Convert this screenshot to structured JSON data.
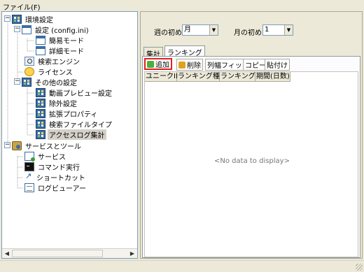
{
  "menu": {
    "file_label": "ファイル(F)"
  },
  "tree": {
    "items": [
      {
        "label": "環境設定",
        "icon": "settings-grid-icon"
      },
      {
        "label": "設定 (config.ini)",
        "icon": "window-icon"
      },
      {
        "label": "簡易モード",
        "icon": "window-icon"
      },
      {
        "label": "詳細モード",
        "icon": "window-icon"
      },
      {
        "label": "検索エンジン",
        "icon": "search-engine-icon"
      },
      {
        "label": "ライセンス",
        "icon": "license-icon"
      },
      {
        "label": "その他の設定",
        "icon": "settings-grid-icon"
      },
      {
        "label": "動画プレビュー設定",
        "icon": "settings-grid-icon"
      },
      {
        "label": "除外設定",
        "icon": "settings-grid-icon"
      },
      {
        "label": "拡張プロパティ",
        "icon": "settings-grid-icon"
      },
      {
        "label": "検索ファイルタイプ",
        "icon": "settings-grid-icon"
      },
      {
        "label": "アクセスログ集計",
        "icon": "settings-grid-icon"
      },
      {
        "label": "サービスとツール",
        "icon": "tools-icon"
      },
      {
        "label": "サービス",
        "icon": "service-icon"
      },
      {
        "label": "コマンド実行",
        "icon": "command-icon"
      },
      {
        "label": "ショートカット",
        "icon": "shortcut-icon"
      },
      {
        "label": "ログビューアー",
        "icon": "log-viewer-icon"
      }
    ],
    "selected_index": 11,
    "expander_symbol": "−"
  },
  "filters": {
    "week_start_label": "週の初め",
    "week_start_value": "月",
    "month_start_label": "月の初め",
    "month_start_value": "1",
    "dropdown_glyph": "▼"
  },
  "tabs": [
    {
      "label": "集計",
      "active": false
    },
    {
      "label": "ランキング",
      "active": true
    }
  ],
  "toolbar": {
    "add_label": "追加",
    "delete_label": "削除",
    "fit_columns_label": "列幅フィット",
    "copy_label": "コピー",
    "paste_label": "貼付け",
    "add_highlight_color": "#e02020"
  },
  "grid": {
    "columns": [
      "ユニークID",
      "ランキング種類",
      "ランキング数",
      "期間(日数)"
    ],
    "empty_message": "<No data to display>"
  },
  "scrollbar": {
    "left_glyph": "◀",
    "right_glyph": "▶"
  }
}
